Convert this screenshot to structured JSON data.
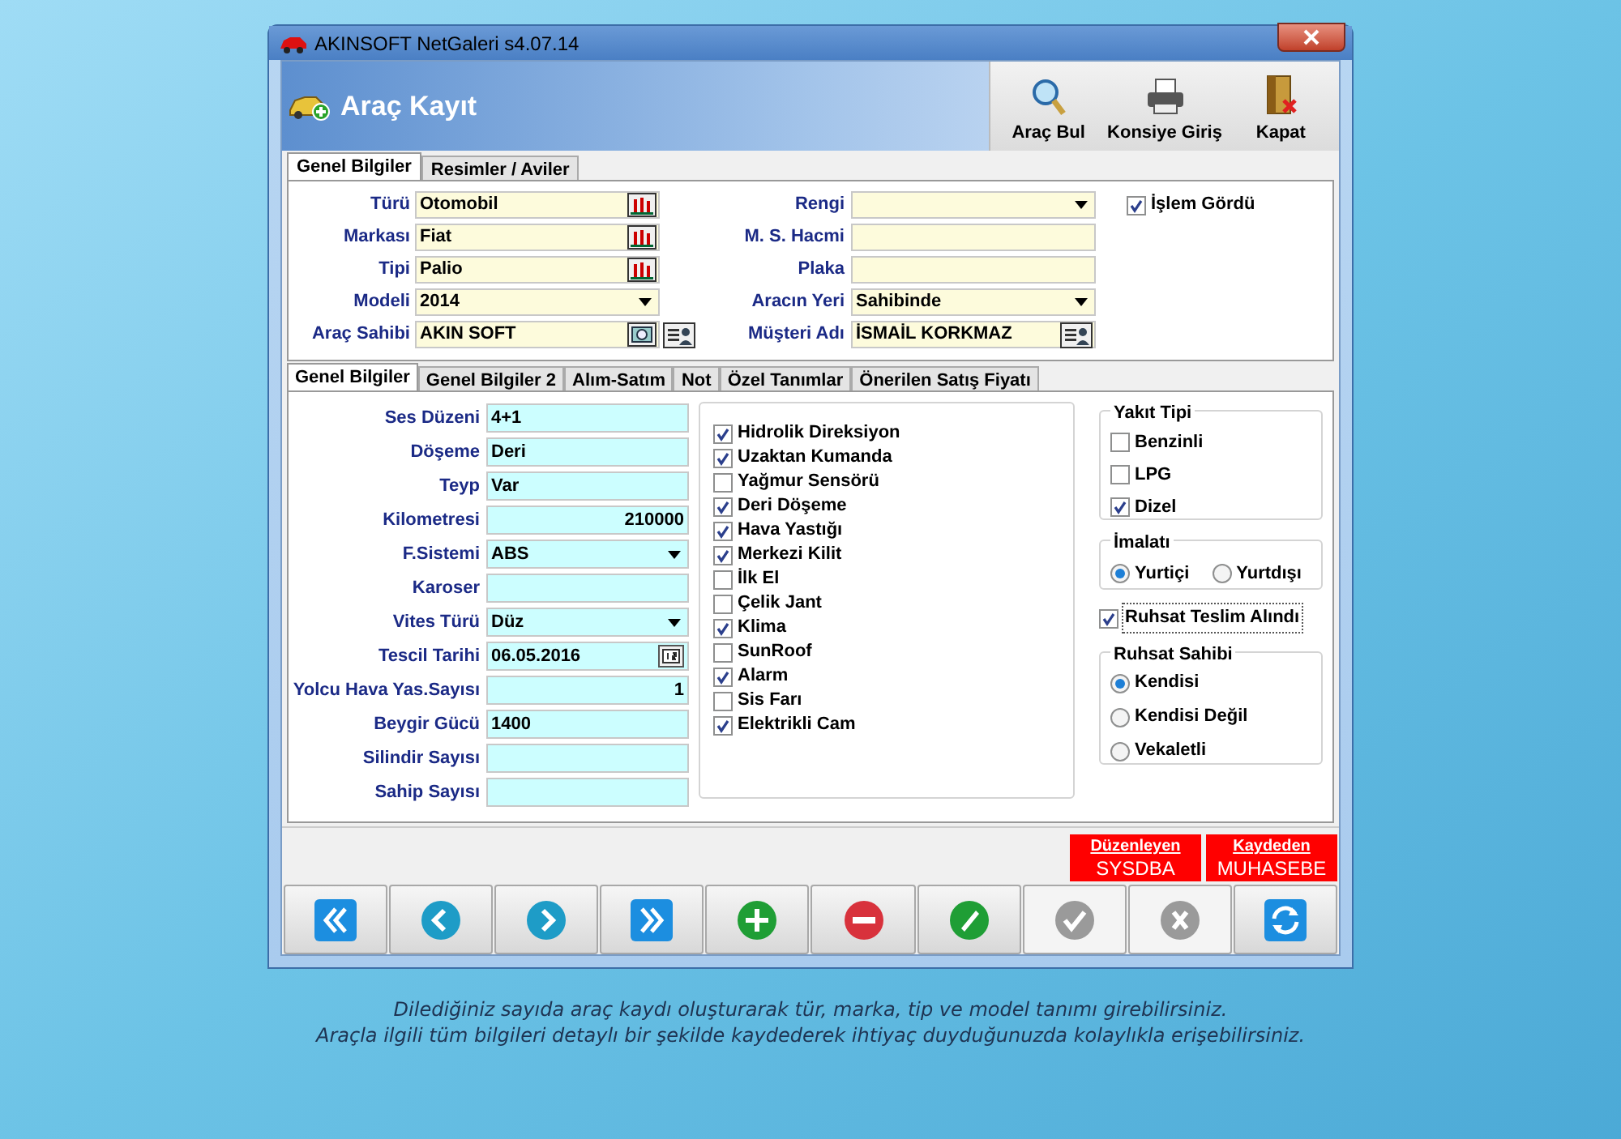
{
  "window": {
    "title": "AKINSOFT NetGaleri s4.07.14"
  },
  "header": {
    "title": "Araç Kayıt",
    "toolbar": [
      {
        "kind": "search",
        "label": "Araç Bul"
      },
      {
        "kind": "printer",
        "label": "Konsiye Giriş"
      },
      {
        "kind": "exit",
        "label": "Kapat"
      }
    ]
  },
  "tabs": [
    {
      "label": "Genel Bilgiler",
      "selected": true
    },
    {
      "label": "Resimler / Aviler",
      "selected": false
    }
  ],
  "vehicle": {
    "left_fields": [
      {
        "label": "Türü",
        "value": "Otomobil",
        "kind": "lookup"
      },
      {
        "label": "Markası",
        "value": "Fiat",
        "kind": "lookup"
      },
      {
        "label": "Tipi",
        "value": "Palio",
        "kind": "lookup"
      },
      {
        "label": "Modeli",
        "value": "2014",
        "kind": "dropdown"
      },
      {
        "label": "Araç Sahibi",
        "value": "AKIN SOFT",
        "kind": "owner"
      }
    ],
    "right_fields": [
      {
        "label": "Rengi",
        "kind": "dropdown"
      },
      {
        "label": "M. S. Hacmi",
        "kind": "text"
      },
      {
        "label": "Plaka",
        "kind": "text"
      },
      {
        "label": "Aracın Yeri",
        "value": "Sahibinde",
        "kind": "dropdown"
      },
      {
        "label": "Müşteri Adı",
        "value": "İSMAİL KORKMAZ",
        "kind": "person"
      }
    ],
    "processed": {
      "label": "İşlem Gördü",
      "checked": true
    }
  },
  "inner_tabs": [
    {
      "label": "Genel Bilgiler",
      "selected": true
    },
    {
      "label": "Genel Bilgiler 2",
      "selected": false
    },
    {
      "label": "Alım-Satım",
      "selected": false
    },
    {
      "label": "Not",
      "selected": false
    },
    {
      "label": "Özel Tanımlar",
      "selected": false
    },
    {
      "label": "Önerilen Satış Fiyatı",
      "selected": false
    }
  ],
  "details": [
    {
      "label": "Ses Düzeni",
      "value": "4+1",
      "kind": "text"
    },
    {
      "label": "Döşeme",
      "value": "Deri",
      "kind": "text"
    },
    {
      "label": "Teyp",
      "value": "Var",
      "kind": "text"
    },
    {
      "label": "Kilometresi",
      "value": "210000",
      "kind": "number"
    },
    {
      "label": "F.Sistemi",
      "value": "ABS",
      "kind": "dropdown"
    },
    {
      "label": "Karoser",
      "kind": "text"
    },
    {
      "label": "Vites Türü",
      "value": "Düz",
      "kind": "dropdown"
    },
    {
      "label": "Tescil Tarihi",
      "value": "06.05.2016",
      "kind": "date"
    },
    {
      "label": "Yolcu Hava Yas.Sayısı",
      "value": "1",
      "kind": "number"
    },
    {
      "label": "Beygir Gücü",
      "value": "1400",
      "kind": "text"
    },
    {
      "label": "Silindir Sayısı",
      "kind": "text"
    },
    {
      "label": "Sahip Sayısı",
      "kind": "text"
    }
  ],
  "features": [
    {
      "label": "Hidrolik Direksiyon",
      "checked": true
    },
    {
      "label": "Uzaktan Kumanda",
      "checked": true
    },
    {
      "label": "Yağmur Sensörü",
      "checked": false
    },
    {
      "label": "Deri Döşeme",
      "checked": true
    },
    {
      "label": "Hava Yastığı",
      "checked": true
    },
    {
      "label": "Merkezi Kilit",
      "checked": true
    },
    {
      "label": "İlk El",
      "checked": false
    },
    {
      "label": "Çelik Jant",
      "checked": false
    },
    {
      "label": "Klima",
      "checked": true
    },
    {
      "label": "SunRoof",
      "checked": false
    },
    {
      "label": "Alarm",
      "checked": true
    },
    {
      "label": "Sis Farı",
      "checked": false
    },
    {
      "label": "Elektrikli Cam",
      "checked": true
    }
  ],
  "fuel": {
    "title": "Yakıt Tipi",
    "options": [
      {
        "label": "Benzinli",
        "checked": false
      },
      {
        "label": "LPG",
        "checked": false
      },
      {
        "label": "Dizel",
        "checked": true
      }
    ]
  },
  "origin": {
    "title": "İmalatı",
    "options": [
      {
        "label": "Yurtiçi",
        "selected": true
      },
      {
        "label": "Yurtdışı",
        "selected": false
      }
    ]
  },
  "license_received": {
    "label": "Ruhsat Teslim Alındı",
    "checked": true
  },
  "license_owner": {
    "title": "Ruhsat Sahibi",
    "options": [
      {
        "label": "Kendisi",
        "selected": true
      },
      {
        "label": "Kendisi Değil",
        "selected": false
      },
      {
        "label": "Vekaletli",
        "selected": false
      }
    ]
  },
  "audit": [
    {
      "label": "Düzenleyen",
      "value": "SYSDBA"
    },
    {
      "label": "Kaydeden",
      "value": "MUHASEBE"
    }
  ],
  "nav_buttons": [
    {
      "kind": "first",
      "disabled": false
    },
    {
      "kind": "prev",
      "disabled": false
    },
    {
      "kind": "next",
      "disabled": false
    },
    {
      "kind": "last",
      "disabled": false
    },
    {
      "kind": "add",
      "disabled": false
    },
    {
      "kind": "delete",
      "disabled": false
    },
    {
      "kind": "edit",
      "disabled": false
    },
    {
      "kind": "save",
      "disabled": true
    },
    {
      "kind": "cancel",
      "disabled": true
    },
    {
      "kind": "refresh",
      "disabled": false
    }
  ],
  "caption": [
    "Dilediğiniz sayıda araç kaydı oluşturarak tür, marka, tip ve model tanımı girebilirsiniz.",
    "Araçla ilgili tüm bilgileri detaylı bir şekilde kaydederek ihtiyaç duyduğunuzda kolaylıkla erişebilirsiniz."
  ]
}
